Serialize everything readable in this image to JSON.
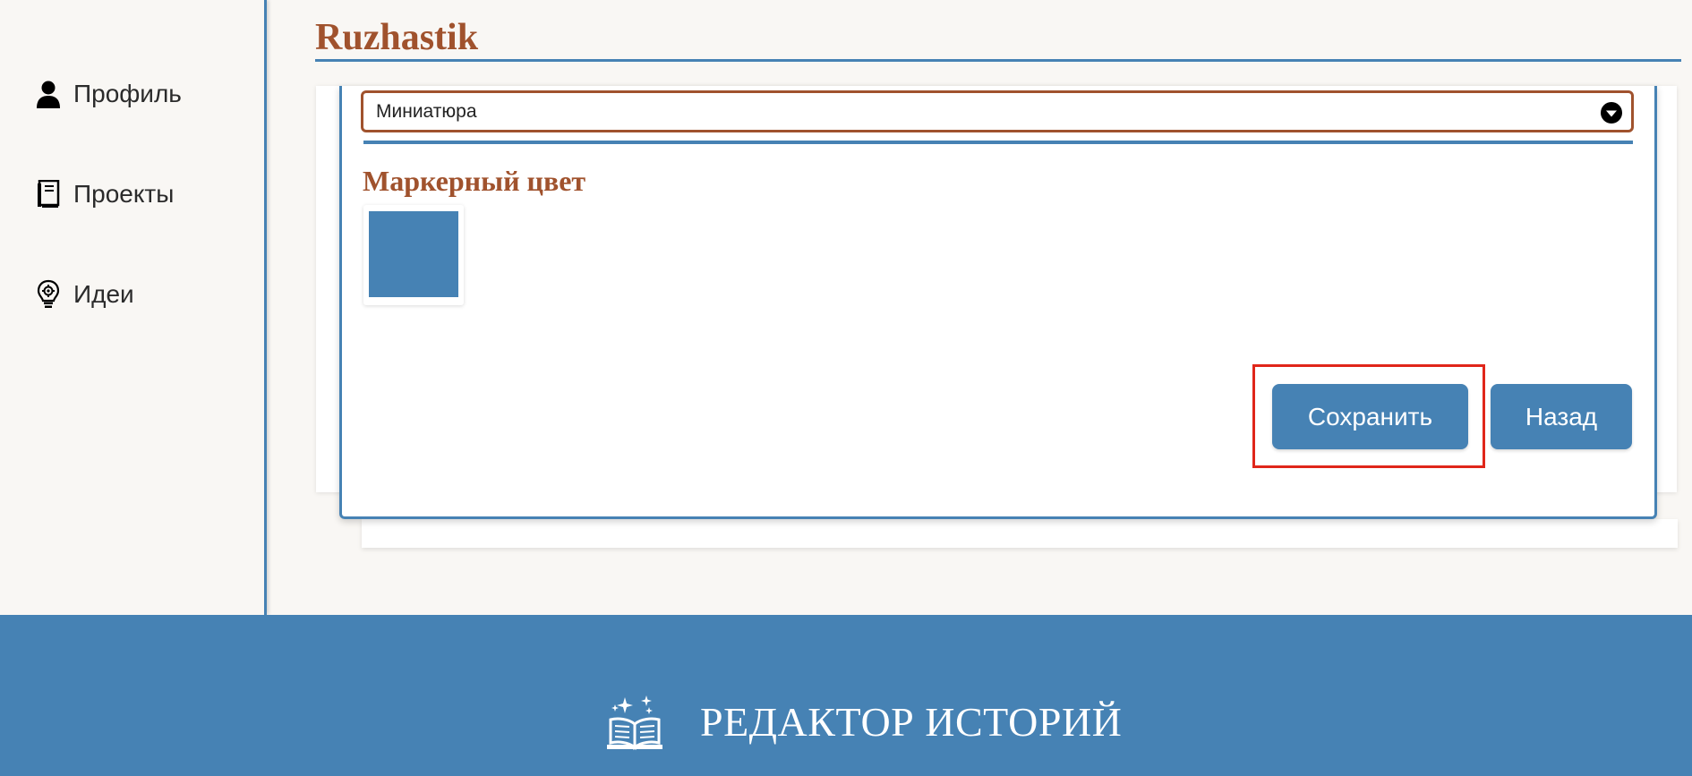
{
  "sidebar": {
    "items": [
      {
        "label": "Профиль",
        "icon": "user-icon"
      },
      {
        "label": "Проекты",
        "icon": "notebook-icon"
      },
      {
        "label": "Идеи",
        "icon": "lightbulb-gear-icon"
      }
    ]
  },
  "header": {
    "title": "Ruzhastik"
  },
  "modal": {
    "select_value": "Миниатюра",
    "section_heading": "Маркерный цвет",
    "marker_color": "#4682b4",
    "save_label": "Сохранить",
    "back_label": "Назад"
  },
  "footer": {
    "brand": "РЕДАКТОР ИСТОРИЙ",
    "logo_icon": "open-book-sparkles-icon"
  },
  "colors": {
    "accent": "#4682b4",
    "brand_brown": "#a0522d",
    "background": "#f9f7f4",
    "highlight": "#e0261a"
  }
}
